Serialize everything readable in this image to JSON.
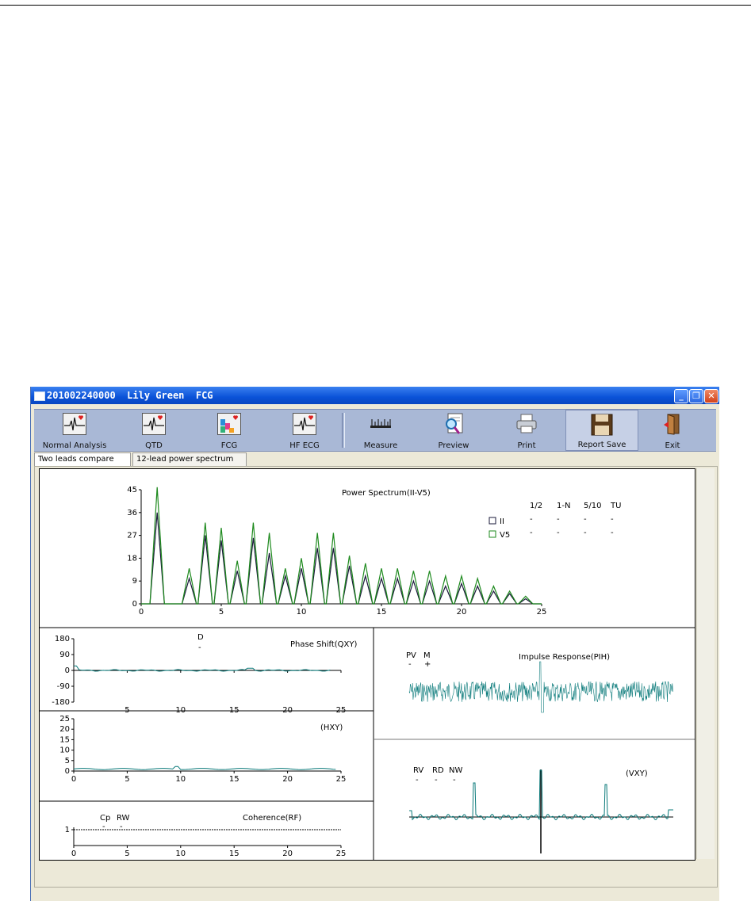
{
  "window": {
    "title": "201002240000  Lily Green  FCG",
    "controls": [
      "_",
      "❐",
      "✕"
    ]
  },
  "toolbar": [
    {
      "label": "Normal Analysis",
      "icon": "ecg-heart-icon"
    },
    {
      "label": "QTD",
      "icon": "ecg-heart-icon"
    },
    {
      "label": "FCG",
      "icon": "spectrum-heart-icon"
    },
    {
      "label": "HF ECG",
      "icon": "ecg-heart-icon"
    },
    {
      "label": "Measure",
      "icon": "ruler-icon"
    },
    {
      "label": "Preview",
      "icon": "magnifier-document-icon"
    },
    {
      "label": "Print",
      "icon": "printer-icon"
    },
    {
      "label": "Report Save",
      "icon": "floppy-disk-icon"
    },
    {
      "label": "Exit",
      "icon": "exit-door-icon"
    }
  ],
  "tabs": [
    {
      "label": "Two leads compare",
      "selected": true
    },
    {
      "label": "12-lead power spectrum",
      "selected": false
    }
  ],
  "power_spectrum": {
    "title": "Power Spectrum(II-V5)",
    "legend": [
      {
        "name": "II",
        "color": "#1a1a3a"
      },
      {
        "name": "V5",
        "color": "#1e8a1e"
      }
    ],
    "params_header": [
      "1/2",
      "1-N",
      "5/10",
      "TU"
    ],
    "params_rows": [
      [
        "-",
        "-",
        "-",
        "-"
      ],
      [
        "-",
        "-",
        "-",
        "-"
      ]
    ]
  },
  "phase": {
    "title": "Phase Shift(QXY)",
    "param_label": "D",
    "param_value": "-"
  },
  "hxy": {
    "title": "(HXY)"
  },
  "coherence": {
    "title": "Coherence(RF)",
    "params": [
      {
        "label": "Cp",
        "value": "-"
      },
      {
        "label": "RW",
        "value": "-"
      }
    ]
  },
  "impulse": {
    "title": "Impulse Response(PIH)",
    "params": [
      {
        "label": "PV",
        "value": "-"
      },
      {
        "label": "M",
        "value": "+"
      }
    ]
  },
  "vxy": {
    "title": "(VXY)",
    "params": [
      {
        "label": "RV",
        "value": "-"
      },
      {
        "label": "RD",
        "value": "-"
      },
      {
        "label": "NW",
        "value": "-"
      }
    ]
  },
  "chart_data": [
    {
      "type": "line",
      "title": "Power Spectrum(II-V5)",
      "xlim": [
        0,
        25
      ],
      "ylim": [
        0,
        45
      ],
      "xticks": [
        0,
        5,
        10,
        15,
        20,
        25
      ],
      "yticks": [
        0,
        9,
        18,
        27,
        36,
        45
      ],
      "peaks_x": [
        1,
        3,
        4,
        5,
        6,
        7,
        8,
        9,
        10,
        11,
        12,
        13,
        14,
        15,
        16,
        17,
        18,
        19,
        20,
        21,
        22,
        23,
        24
      ],
      "series": [
        {
          "name": "II",
          "color": "#1a1a3a",
          "values": [
            36,
            10,
            27,
            25,
            13,
            26,
            20,
            11,
            14,
            22,
            22,
            15,
            11,
            10,
            10,
            9,
            9,
            7,
            8,
            7,
            5,
            4,
            2
          ]
        },
        {
          "name": "V5",
          "color": "#1e8a1e",
          "values": [
            46,
            14,
            32,
            30,
            17,
            32,
            28,
            14,
            18,
            28,
            28,
            19,
            16,
            14,
            14,
            13,
            13,
            11,
            11,
            10,
            7,
            5,
            3
          ]
        }
      ]
    },
    {
      "type": "line",
      "title": "Phase Shift(QXY)",
      "xlim": [
        0,
        25
      ],
      "ylim": [
        -180,
        180
      ],
      "xticks": [
        5,
        10,
        15,
        20,
        25
      ],
      "yticks": [
        180,
        90,
        0,
        -90,
        -180
      ]
    },
    {
      "type": "line",
      "title": "(HXY)",
      "xlim": [
        0,
        25
      ],
      "ylim": [
        0,
        25
      ],
      "xticks": [
        0,
        5,
        10,
        15,
        20,
        25
      ],
      "yticks": [
        25,
        20,
        15,
        10,
        5,
        0
      ]
    },
    {
      "type": "line",
      "title": "Coherence(RF)",
      "xlim": [
        0,
        25
      ],
      "ylim": [
        0,
        1
      ],
      "xticks": [
        0,
        5,
        10,
        15,
        20,
        25
      ],
      "yticks": [
        1
      ]
    },
    {
      "type": "line",
      "title": "Impulse Response(PIH)"
    },
    {
      "type": "line",
      "title": "(VXY)"
    }
  ]
}
